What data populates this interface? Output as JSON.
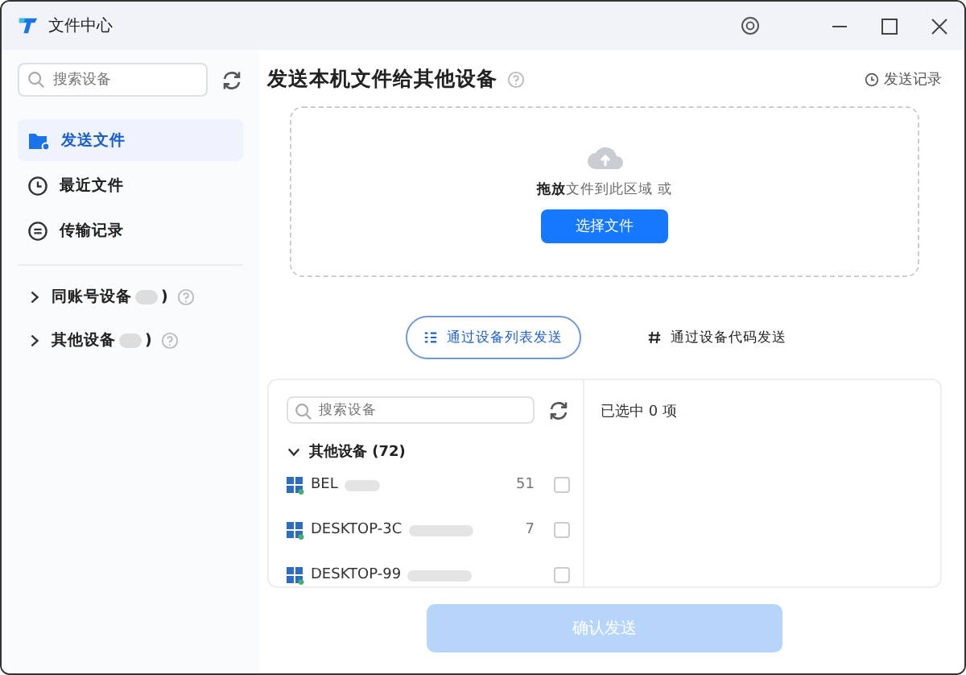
{
  "window": {
    "title": "文件中心"
  },
  "sidebar": {
    "search": {
      "placeholder": "搜索设备"
    },
    "items": [
      {
        "label": "发送文件",
        "kind": "folder",
        "selected": true
      },
      {
        "label": "最近文件",
        "kind": "clock",
        "selected": false
      },
      {
        "label": "传输记录",
        "kind": "list",
        "selected": false
      }
    ],
    "groups": [
      {
        "label": "同账号设备",
        "suffix": ")",
        "expanded": false
      },
      {
        "label": "其他设备",
        "suffix": ")",
        "expanded": false
      }
    ]
  },
  "main": {
    "title": "发送本机文件给其他设备",
    "history_link": "发送记录",
    "drop_zone": {
      "text": "**拖放**文件到此区域 或",
      "button": "选择文件"
    },
    "tabs": [
      {
        "label": "通过设备列表发送",
        "kind": "list",
        "selected": true
      },
      {
        "label": "通过设备代码发送",
        "kind": "code",
        "selected": false
      }
    ],
    "device_search": {
      "placeholder": "搜索设备"
    },
    "device_group": {
      "label": "其他设备 (72)",
      "expanded": true
    },
    "devices": [
      {
        "name": "BEL",
        "address": "51",
        "checked": false
      },
      {
        "name": "DESKTOP-3C",
        "address": "7",
        "checked": false
      },
      {
        "name": "DESKTOP-99",
        "checked": false
      }
    ],
    "selected_count": "已选中 0 项",
    "confirm_button": {
      "label": "确认发送",
      "disabled": true
    }
  }
}
